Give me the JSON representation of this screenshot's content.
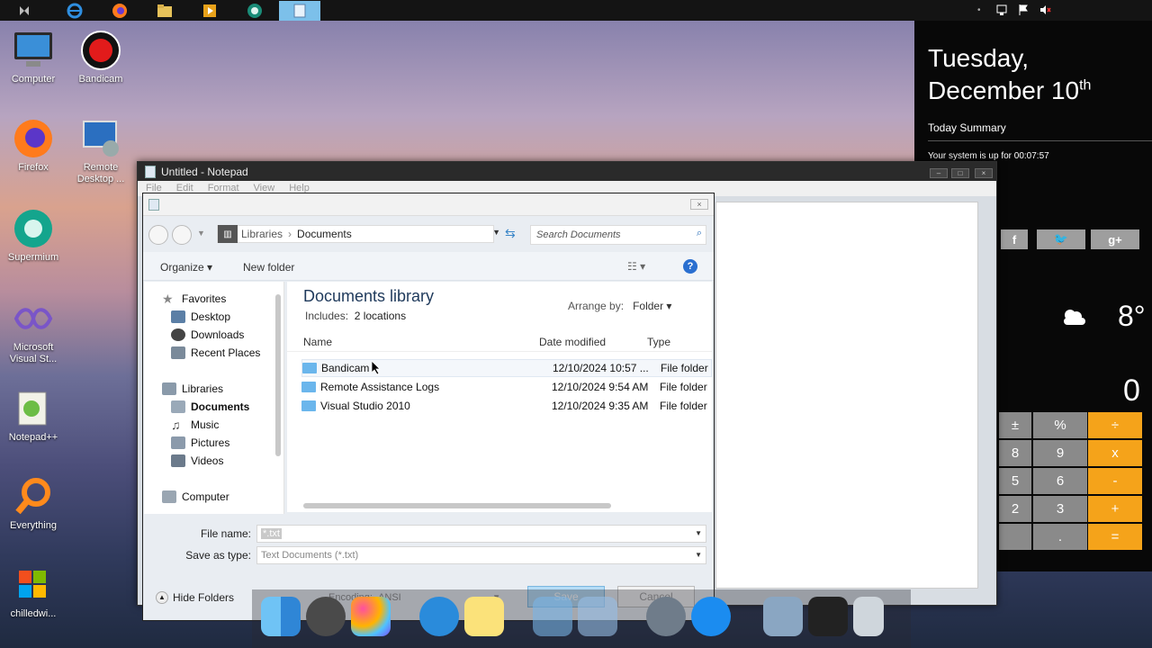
{
  "taskbar": {
    "apps": [
      "start-icon",
      "internet-explorer-icon",
      "firefox-icon",
      "file-explorer-icon",
      "media-player-icon",
      "supermium-icon",
      "notepad-icon"
    ],
    "active_index": 6,
    "tray": [
      "network-icon",
      "action-center-flag-icon",
      "volume-muted-icon"
    ]
  },
  "desktop": {
    "icons": [
      {
        "label": "Computer"
      },
      {
        "label": "Bandicam"
      },
      {
        "label": "Firefox"
      },
      {
        "label": "Remote Desktop ..."
      },
      {
        "label": "Supermium"
      },
      {
        "label": "Microsoft Visual St..."
      },
      {
        "label": "Notepad++"
      },
      {
        "label": "Everything"
      },
      {
        "label": "chilledwi..."
      }
    ]
  },
  "widgets": {
    "day": "Tuesday,",
    "date": "December 10",
    "date_suffix": "th",
    "summary_title": "Today Summary",
    "uptime": "Your system is up for 00:07:57",
    "social": [
      "f",
      "🐦",
      "g+"
    ],
    "weather_temp": "8°",
    "calc_display": "0",
    "calc_keys": [
      [
        "±",
        "%",
        "÷"
      ],
      [
        "8",
        "9",
        "x"
      ],
      [
        "5",
        "6",
        "-"
      ],
      [
        "2",
        "3",
        "+"
      ],
      [
        "",
        ".",
        "="
      ]
    ]
  },
  "notepad": {
    "title": "Untitled - Notepad",
    "menu": [
      "File",
      "Edit",
      "Format",
      "View",
      "Help"
    ]
  },
  "dialog": {
    "breadcrumb_root": "Libraries",
    "breadcrumb_current": "Documents",
    "search_placeholder": "Search Documents",
    "organize": "Organize",
    "new_folder": "New folder",
    "nav": {
      "favorites": "Favorites",
      "desktop": "Desktop",
      "downloads": "Downloads",
      "recent": "Recent Places",
      "libraries": "Libraries",
      "documents": "Documents",
      "music": "Music",
      "pictures": "Pictures",
      "videos": "Videos",
      "computer": "Computer"
    },
    "library_title": "Documents library",
    "includes_label": "Includes:",
    "includes_value": "2 locations",
    "arrange_label": "Arrange by:",
    "arrange_value": "Folder",
    "columns": {
      "name": "Name",
      "date": "Date modified",
      "type": "Type"
    },
    "rows": [
      {
        "name": "Bandicam",
        "date": "12/10/2024 10:57 ...",
        "type": "File folder"
      },
      {
        "name": "Remote Assistance Logs",
        "date": "12/10/2024 9:54 AM",
        "type": "File folder"
      },
      {
        "name": "Visual Studio 2010",
        "date": "12/10/2024 9:35 AM",
        "type": "File folder"
      }
    ],
    "file_name_label": "File name:",
    "file_name_value": "*.txt",
    "save_type_label": "Save as type:",
    "save_type_value": "Text Documents (*.txt)",
    "hide_folders": "Hide Folders",
    "encoding_label": "Encoding:",
    "encoding_value": "ANSI",
    "save": "Save",
    "cancel": "Cancel"
  },
  "dock": [
    "finder-icon",
    "system-preferences-icon",
    "game-center-icon",
    "safari-icon",
    "notes-icon",
    "window-icon",
    "app-store-folder-icon",
    "launchpad-rocket-icon",
    "app-store-icon",
    "preview-icon",
    "photo-booth-icon",
    "trash-icon"
  ]
}
